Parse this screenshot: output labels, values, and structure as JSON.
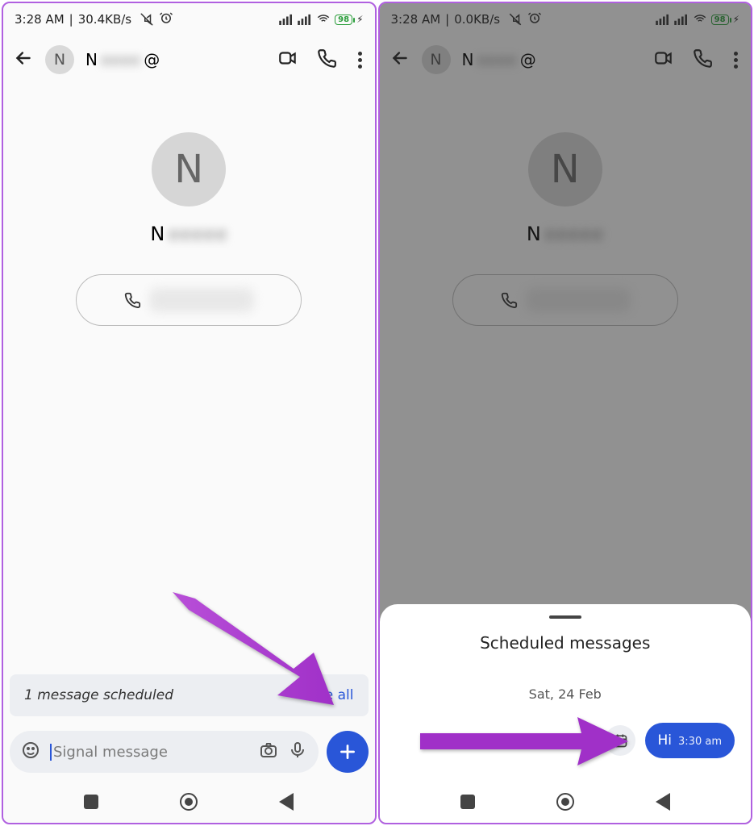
{
  "left": {
    "status": {
      "time": "3:28 AM",
      "speed": "30.4KB/s",
      "battery": "98"
    },
    "contact": {
      "initial": "N",
      "name_prefix": "N",
      "at_symbol": "@"
    },
    "scheduled_bar": {
      "count_text": "1 message scheduled",
      "see_all": "See all"
    },
    "composer": {
      "placeholder": "Signal message"
    }
  },
  "right": {
    "status": {
      "time": "3:28 AM",
      "speed": "0.0KB/s",
      "battery": "98"
    },
    "contact": {
      "initial": "N",
      "name_prefix": "N",
      "at_symbol": "@"
    },
    "sheet": {
      "title": "Scheduled messages",
      "date": "Sat, 24 Feb",
      "message_text": "Hi",
      "message_time": "3:30 am"
    }
  }
}
